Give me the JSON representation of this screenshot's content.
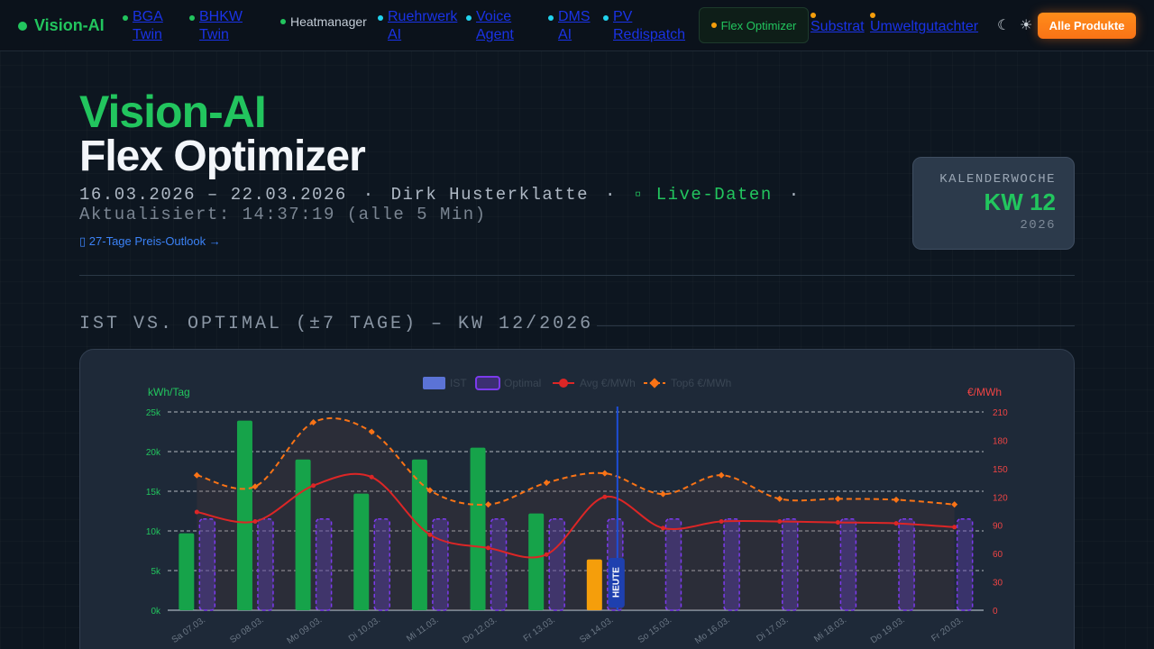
{
  "nav": {
    "brand": "Vision-AI",
    "items": [
      {
        "label": "BGA Twin",
        "line1": "BGA",
        "line2": "Twin",
        "dot": "#22c55e"
      },
      {
        "label": "BHKW Twin",
        "line1": "BHKW",
        "line2": "Twin",
        "dot": "#22c55e"
      },
      {
        "label": "Heatmanager",
        "dot": "#22c55e"
      },
      {
        "label": "Ruehrwerk AI",
        "line1": "Ruehrwerk",
        "line2": "AI",
        "dot": "#22d3ee"
      },
      {
        "label": "Voice Agent",
        "line1": "Voice",
        "line2": "Agent",
        "dot": "#22d3ee"
      },
      {
        "label": "DMS AI",
        "line1": "DMS",
        "line2": "AI",
        "dot": "#22d3ee"
      },
      {
        "label": "PV Redispatch",
        "line1": "PV",
        "line2": "Redispatch",
        "dot": "#22d3ee"
      },
      {
        "label": "Flex Optimizer",
        "dot": "#f59e0b"
      },
      {
        "label": "Substrat",
        "dot": "#f59e0b"
      },
      {
        "label": "Umweltgutachter",
        "dot": "#f59e0b"
      }
    ],
    "dark_icon": "☾",
    "light_icon": "☀",
    "products_button": "Alle Produkte"
  },
  "header": {
    "title_line1": "Vision-AI",
    "title_line2": "Flex Optimizer",
    "date_range": "16.03.2026 – 22.03.2026",
    "user": "Dirk Husterklatte",
    "live_icon": "▫",
    "live_label": "Live-Daten",
    "separator": "·",
    "updated": "Aktualisiert: 14:37:19 (alle 5 Min)",
    "outlook_icon": "▯",
    "outlook_link": "27-Tage Preis-Outlook →"
  },
  "week_box": {
    "label": "KALENDERWOCHE",
    "value": "KW 12",
    "year": "2026"
  },
  "section": {
    "title": "IST VS. OPTIMAL (±7 TAGE) – KW 12/2026"
  },
  "chart_data": {
    "type": "bar",
    "categories": [
      "Sa 07.03.",
      "So 08.03.",
      "Mo 09.03.",
      "Di 10.03.",
      "Mi 11.03.",
      "Do 12.03.",
      "Fr 13.03.",
      "Sa 14.03.",
      "So 15.03.",
      "Mo 16.03.",
      "Di 17.03.",
      "Mi 18.03.",
      "Do 19.03.",
      "Fr 20.03."
    ],
    "y_left": {
      "label": "kWh/Tag",
      "min": 0,
      "max": 25000,
      "ticks": [
        "0k",
        "5k",
        "10k",
        "15k",
        "20k",
        "25k"
      ]
    },
    "y_right": {
      "label": "€/MWh",
      "min": 0,
      "max": 210,
      "ticks": [
        "0",
        "30",
        "60",
        "90",
        "120",
        "150",
        "180",
        "210"
      ]
    },
    "today_marker": {
      "label": "HEUTE",
      "index": 7
    },
    "legend_position": "top",
    "series": [
      {
        "name": "IST",
        "kind": "bar",
        "color": "#16a34a",
        "values": [
          9700,
          23900,
          19000,
          14700,
          19000,
          20500,
          12200,
          6400,
          null,
          null,
          null,
          null,
          null,
          null
        ]
      },
      {
        "name": "Optimal",
        "kind": "bar-dashed",
        "color": "#7c3aed",
        "values": [
          11500,
          11500,
          11500,
          11500,
          11500,
          11500,
          11500,
          11500,
          11500,
          11500,
          11500,
          11500,
          11500,
          11500
        ]
      },
      {
        "name": "Avg €/MWh",
        "kind": "line",
        "axis": "right",
        "color": "#dc2626",
        "values": [
          104,
          94,
          132,
          141,
          80,
          66,
          59,
          120,
          87,
          94,
          94,
          93,
          92,
          88
        ]
      },
      {
        "name": "Top6 €/MWh",
        "kind": "line-dashed",
        "axis": "right",
        "color": "#f97316",
        "values": [
          143,
          131,
          199,
          189,
          127,
          112,
          135,
          145,
          123,
          143,
          118,
          118,
          117,
          112
        ]
      }
    ],
    "colors": {
      "today_bar": "#f59e0b",
      "grid": "#e5e7eb"
    }
  }
}
